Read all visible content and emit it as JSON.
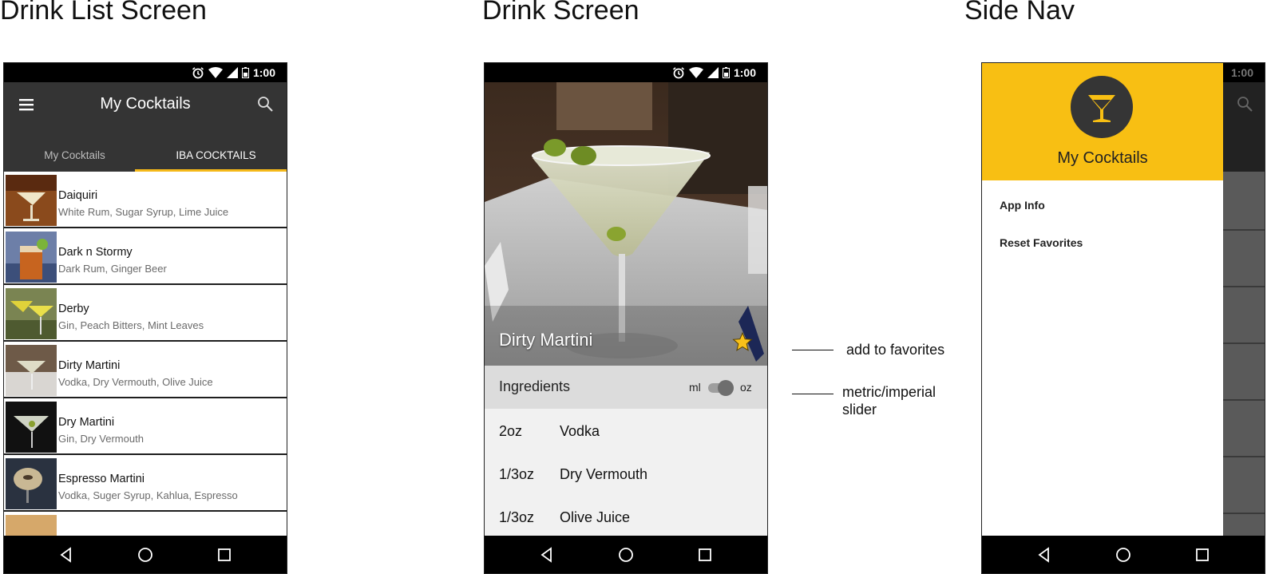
{
  "sections": {
    "list_title": "Drink List Screen",
    "drink_title": "Drink Screen",
    "nav_title": "Side Nav"
  },
  "status": {
    "time": "1:00"
  },
  "list_screen": {
    "app_title": "My Cocktails",
    "tabs": [
      {
        "label": "My Cocktails",
        "selected": false
      },
      {
        "label": "IBA COCKTAILS",
        "selected": true
      }
    ],
    "items": [
      {
        "name": "Daiquiri",
        "ingredients": "White Rum, Sugar Syrup, Lime Juice"
      },
      {
        "name": "Dark n Stormy",
        "ingredients": "Dark Rum, Ginger Beer"
      },
      {
        "name": "Derby",
        "ingredients": "Gin, Peach Bitters, Mint Leaves"
      },
      {
        "name": "Dirty Martini",
        "ingredients": "Vodka, Dry Vermouth, Olive Juice"
      },
      {
        "name": "Dry Martini",
        "ingredients": "Gin, Dry Vermouth"
      },
      {
        "name": "Espresso Martini",
        "ingredients": "Vodka, Suger Syrup, Kahlua, Espresso"
      }
    ]
  },
  "drink_screen": {
    "drink_name": "Dirty Martini",
    "ingredients_label": "Ingredients",
    "unit_metric": "ml",
    "unit_imperial": "oz",
    "ingredients": [
      {
        "amount": "2oz",
        "name": "Vodka"
      },
      {
        "amount": "1/3oz",
        "name": "Dry Vermouth"
      },
      {
        "amount": "1/3oz",
        "name": "Olive Juice"
      }
    ],
    "annotations": {
      "favorites": "add to favorites",
      "slider_line1": "metric/imperial",
      "slider_line2": "slider"
    }
  },
  "side_nav": {
    "title": "My Cocktails",
    "items": [
      "App Info",
      "Reset Favorites"
    ]
  },
  "colors": {
    "accent": "#f5b91a",
    "appbar": "#343434",
    "drawer_header": "#f8bf13"
  }
}
